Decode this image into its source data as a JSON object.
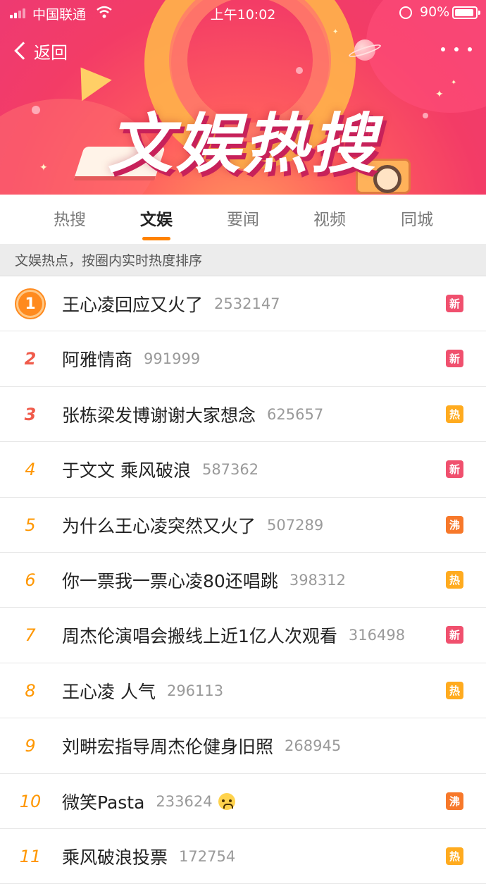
{
  "status_bar": {
    "carrier": "中国联通",
    "time": "上午10:02",
    "battery": "90%"
  },
  "nav": {
    "back_label": "返回"
  },
  "banner": {
    "title": "文娱热搜"
  },
  "tabs": [
    {
      "label": "热搜",
      "active": false
    },
    {
      "label": "文娱",
      "active": true
    },
    {
      "label": "要闻",
      "active": false
    },
    {
      "label": "视频",
      "active": false
    },
    {
      "label": "同城",
      "active": false
    }
  ],
  "subtitle": "文娱热点，按圈内实时热度排序",
  "colors": {
    "accent": "#ff8200",
    "rank_top": "#f05b4b",
    "rank_other": "#ff9700",
    "badge_new": "#f0506e",
    "badge_hot": "#ffab1f",
    "badge_boil": "#f7782a"
  },
  "items": [
    {
      "rank": "1",
      "title": "王心凌回应又火了",
      "count": "2532147",
      "badge": "新",
      "badge_type": "new"
    },
    {
      "rank": "2",
      "title": "阿雅情商",
      "count": "991999",
      "badge": "新",
      "badge_type": "new"
    },
    {
      "rank": "3",
      "title": "张栋梁发博谢谢大家想念",
      "count": "625657",
      "badge": "热",
      "badge_type": "hot"
    },
    {
      "rank": "4",
      "title": "于文文 乘风破浪",
      "count": "587362",
      "badge": "新",
      "badge_type": "new"
    },
    {
      "rank": "5",
      "title": "为什么王心凌突然又火了",
      "count": "507289",
      "badge": "沸",
      "badge_type": "boil"
    },
    {
      "rank": "6",
      "title": "你一票我一票心凌80还唱跳",
      "count": "398312",
      "badge": "热",
      "badge_type": "hot"
    },
    {
      "rank": "7",
      "title": "周杰伦演唱会搬线上近1亿人次观看",
      "count": "316498",
      "badge": "新",
      "badge_type": "new"
    },
    {
      "rank": "8",
      "title": "王心凌 人气",
      "count": "296113",
      "badge": "热",
      "badge_type": "hot"
    },
    {
      "rank": "9",
      "title": "刘畊宏指导周杰伦健身旧照",
      "count": "268945",
      "badge": "",
      "badge_type": "none"
    },
    {
      "rank": "10",
      "title": "微笑Pasta",
      "count": "233624",
      "badge": "沸",
      "badge_type": "boil",
      "emoji": "crying-face-icon"
    },
    {
      "rank": "11",
      "title": "乘风破浪投票",
      "count": "172754",
      "badge": "热",
      "badge_type": "hot"
    }
  ]
}
